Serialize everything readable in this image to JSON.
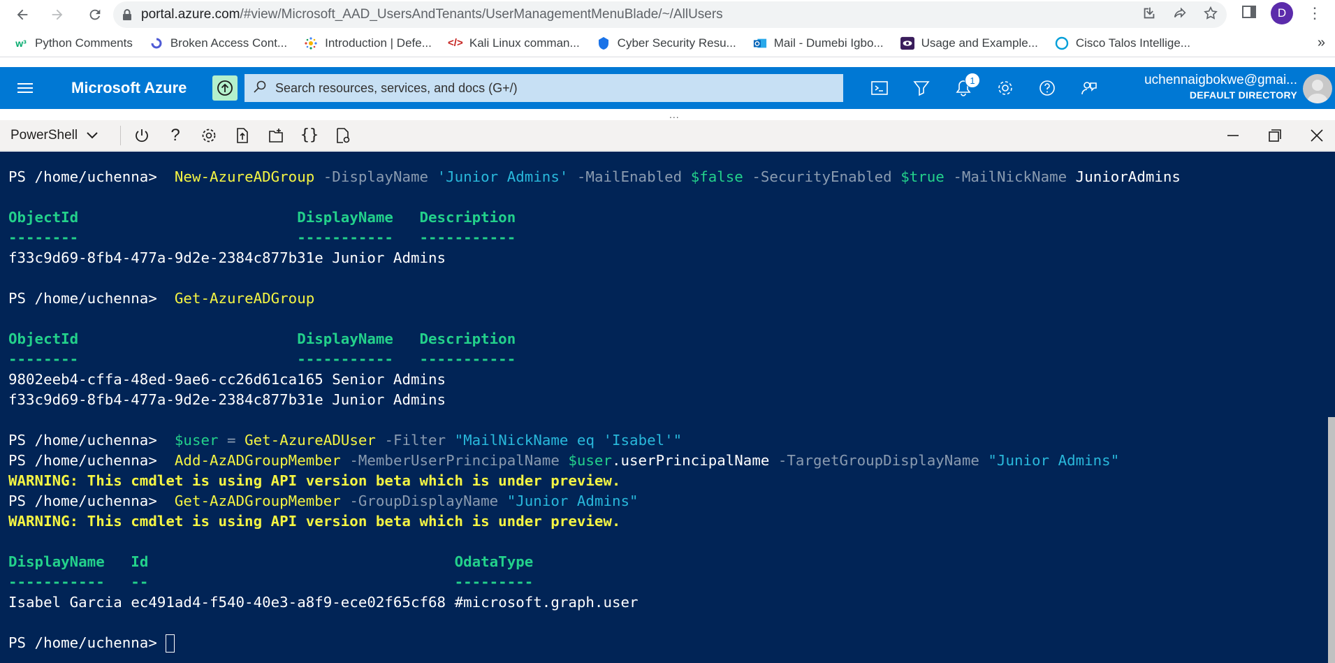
{
  "browser": {
    "url_host": "portal.azure.com",
    "url_path": "/#view/Microsoft_AAD_UsersAndTenants/UserManagementMenuBlade/~/AllUsers",
    "profile_initial": "D",
    "bookmarks": [
      {
        "label": "Python Comments",
        "icon": "w3-icon"
      },
      {
        "label": "Broken Access Cont...",
        "icon": "portswigger-icon"
      },
      {
        "label": "Introduction | Defe...",
        "icon": "dots-icon"
      },
      {
        "label": "Kali Linux comman...",
        "icon": "code-icon"
      },
      {
        "label": "Cyber Security Resu...",
        "icon": "shield-icon"
      },
      {
        "label": "Mail - Dumebi Igbo...",
        "icon": "outlook-icon"
      },
      {
        "label": "Usage and Example...",
        "icon": "eye-icon"
      },
      {
        "label": "Cisco Talos Intellige...",
        "icon": "talos-icon"
      }
    ],
    "more_label": "»"
  },
  "azure": {
    "brand": "Microsoft Azure",
    "search_placeholder": "Search resources, services, and docs (G+/)",
    "notification_count": "1",
    "account_email": "uchennaigbokwe@gmai...",
    "account_directory": "DEFAULT DIRECTORY"
  },
  "shell": {
    "type": "PowerShell"
  },
  "terminal": {
    "prompt": "PS /home/uchenna>",
    "cmd1": {
      "name": "New-AzureADGroup",
      "p1": "-DisplayName",
      "v1": "'Junior Admins'",
      "p2": "-MailEnabled",
      "v2": "$false",
      "p3": "-SecurityEnabled",
      "v3": "$true",
      "p4": "-MailNickName",
      "v4": "JuniorAdmins"
    },
    "table1": {
      "headers": [
        "ObjectId",
        "DisplayName",
        "Description"
      ],
      "dashes": [
        "--------",
        "-----------",
        "-----------"
      ],
      "rows": [
        [
          "f33c9d69-8fb4-477a-9d2e-2384c877b31e",
          "Junior Admins"
        ]
      ]
    },
    "cmd2": "Get-AzureADGroup",
    "table2": {
      "headers": [
        "ObjectId",
        "DisplayName",
        "Description"
      ],
      "dashes": [
        "--------",
        "-----------",
        "-----------"
      ],
      "rows": [
        [
          "9802eeb4-cffa-48ed-9ae6-cc26d61ca165",
          "Senior Admins"
        ],
        [
          "f33c9d69-8fb4-477a-9d2e-2384c877b31e",
          "Junior Admins"
        ]
      ]
    },
    "cmd3": {
      "var": "$user",
      "eq": "=",
      "name": "Get-AzureADUser",
      "p1": "-Filter",
      "v1": "\"MailNickName eq 'Isabel'\""
    },
    "cmd4": {
      "name": "Add-AzADGroupMember",
      "p1": "-MemberUserPrincipalName",
      "v1a": "$user",
      "v1b": ".userPrincipalName",
      "p2": "-TargetGroupDisplayName",
      "v2": "\"Junior Admins\""
    },
    "warning": "WARNING: This cmdlet is using API version beta which is under preview.",
    "cmd5": {
      "name": "Get-AzADGroupMember",
      "p1": "-GroupDisplayName",
      "v1": "\"Junior Admins\""
    },
    "table3": {
      "headers": [
        "DisplayName",
        "Id",
        "OdataType"
      ],
      "dashes": [
        "-----------",
        "--",
        "---------"
      ],
      "rows": [
        [
          "Isabel Garcia",
          "ec491ad4-f540-40e3-a8f9-ece02f65cf68",
          "#microsoft.graph.user"
        ]
      ]
    }
  },
  "colors": {
    "terminal_bg": "#012456",
    "azure_blue": "#0078d4",
    "cmdlet_yellow": "#f5f543",
    "string_cyan": "#29b8db",
    "header_green": "#23d18b"
  }
}
